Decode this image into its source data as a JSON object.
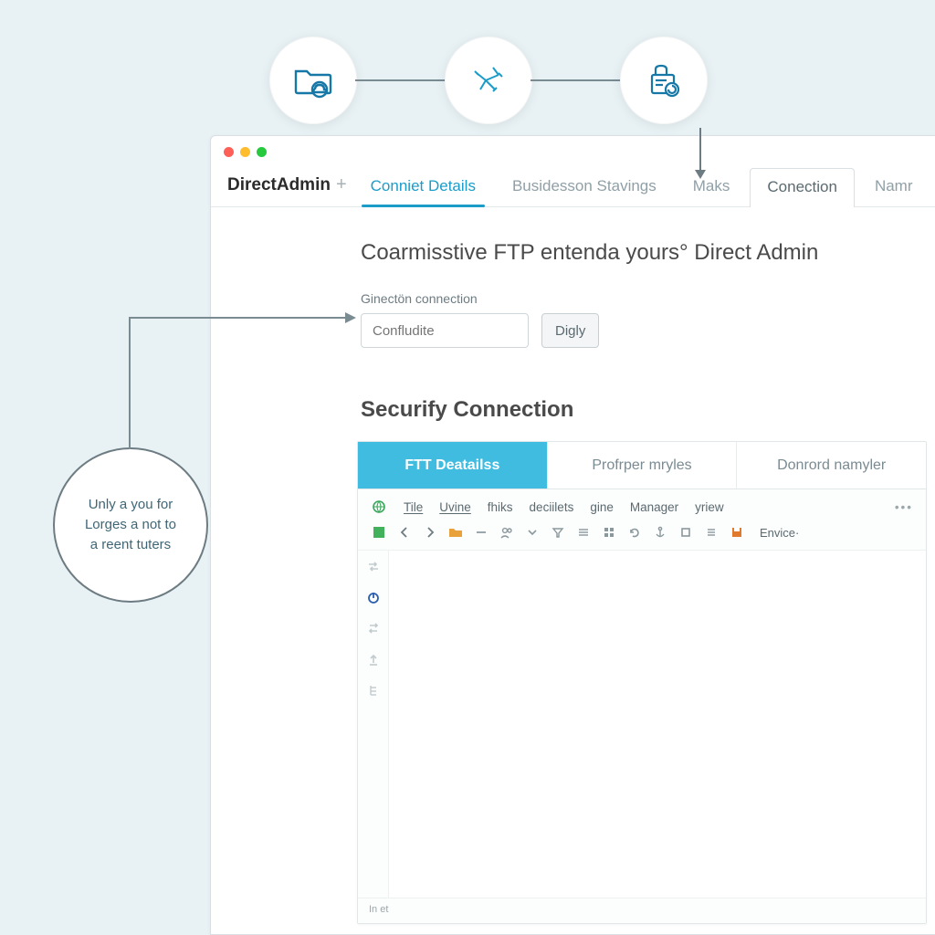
{
  "steps": {
    "icon1": "folder-cloud-icon",
    "icon2": "branches-icon",
    "icon3": "lock-list-icon"
  },
  "window": {
    "brand": "DirectAdmin",
    "tabs": [
      {
        "label": "Conniet Details",
        "kind": "active-primary"
      },
      {
        "label": "Busidesson Stavings",
        "kind": "plain"
      },
      {
        "label": "Maks",
        "kind": "plain"
      },
      {
        "label": "Conection",
        "kind": "boxed"
      },
      {
        "label": "Namr",
        "kind": "plain"
      }
    ]
  },
  "page": {
    "title": "Coarmisstive FTP entenda yours° Direct Admin",
    "field_label": "Ginectön connection",
    "input_placeholder": "Confludite",
    "button_label": "Digly",
    "section_title": "Securify Connection"
  },
  "panel_tabs": [
    {
      "label": "FTT Deatailss",
      "active": true
    },
    {
      "label": "Profrper mryles",
      "active": false
    },
    {
      "label": "Donrord namyler",
      "active": false
    }
  ],
  "ftp_menu": [
    "Tile",
    "Uvine",
    "fhiks",
    "deciilets",
    "gine",
    "Manager",
    "yriew"
  ],
  "ftp_toolbar_env": "Envice·",
  "ftp_status": "In et",
  "callout": {
    "line1": "Unly a you for",
    "line2": "Lorges a not to",
    "line3": "a reent tuters"
  },
  "colors": {
    "accent": "#1b9cc9",
    "accent_fill": "#3fbce0",
    "body_bg": "#e8f2f5"
  }
}
